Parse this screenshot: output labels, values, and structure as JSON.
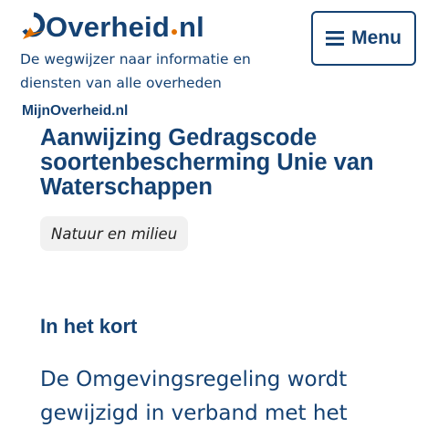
{
  "header": {
    "logo": {
      "name_prefix": "Overheid",
      "name_suffix": "nl",
      "mark_icon": "overheid-logo-mark"
    },
    "tagline": "De wegwijzer naar informatie en diensten van alle overheden",
    "menu_button": {
      "label": "Menu",
      "icon": "hamburger-icon"
    }
  },
  "portal_link": "MijnOverheid.nl",
  "article": {
    "title": "Aanwijzing Gedragscode soortenbescherming Unie van Waterschappen",
    "category_tag": "Natuur en milieu",
    "summary_heading": "In het kort",
    "summary_text": "De Omgevingsregeling wordt gewijzigd in verband met het"
  },
  "colors": {
    "brand_blue": "#154273",
    "accent_orange": "#e17000",
    "tag_background": "#f1f1f1"
  }
}
